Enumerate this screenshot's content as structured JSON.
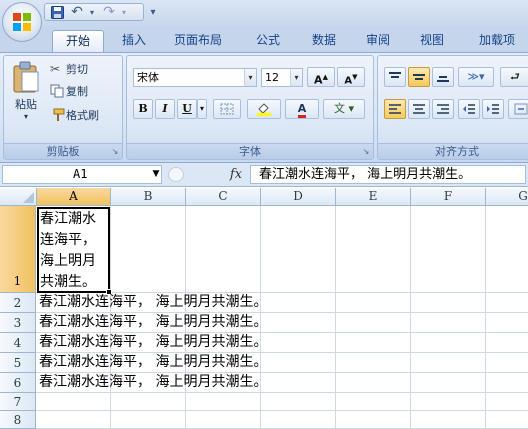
{
  "qat": {
    "save": "save-icon",
    "undo": "↶",
    "redo": "↷",
    "more": "▾"
  },
  "tabs": [
    "开始",
    "插入",
    "页面布局",
    "公式",
    "数据",
    "审阅",
    "视图",
    "加载项"
  ],
  "clipboard": {
    "paste": "粘贴",
    "cut": "剪切",
    "copy": "复制",
    "format_painter": "格式刷",
    "label": "剪贴板"
  },
  "font": {
    "name": "宋体",
    "size": "12",
    "grow": "A",
    "shrink": "A",
    "bold": "B",
    "italic": "I",
    "underline": "U",
    "underline_dd": "▾",
    "label": "字体",
    "wen": "文"
  },
  "alignment": {
    "label": "对齐方式"
  },
  "formula_bar": {
    "name_box": "A1",
    "fx": "fx",
    "content": "春江潮水连海平， 海上明月共潮生。"
  },
  "columns": [
    "A",
    "B",
    "C",
    "D",
    "E",
    "F",
    "G"
  ],
  "rows": [
    "1",
    "2",
    "3",
    "4",
    "5",
    "6",
    "7",
    "8"
  ],
  "cells": {
    "a1": "春江潮水连海平，海上明月共潮生。",
    "a2": "春江潮水连海平， 海上明月共潮生。",
    "a3": "春江潮水连海平， 海上明月共潮生。",
    "a4": "春江潮水连海平， 海上明月共潮生。",
    "a5": "春江潮水连海平， 海上明月共潮生。",
    "a6": "春江潮水连海平， 海上明月共潮生。"
  },
  "colors": {
    "selection_header": "#f1c15f",
    "ribbon": "#dae6f4"
  }
}
